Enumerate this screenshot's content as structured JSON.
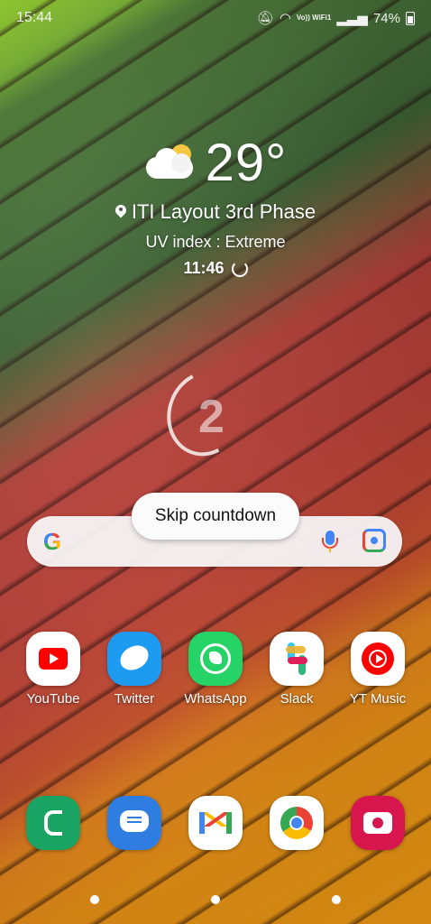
{
  "status_bar": {
    "time": "15:44",
    "signal_label": "Vo)) WiFi1",
    "battery": "74%"
  },
  "weather": {
    "temperature": "29°",
    "location": "ITI Layout 3rd Phase",
    "uv": "UV index : Extreme",
    "updated_time": "11:46"
  },
  "countdown": {
    "number": "2",
    "skip_label": "Skip countdown"
  },
  "search": {
    "google_logo": "G"
  },
  "apps": [
    {
      "label": "YouTube",
      "icon": "youtube-icon"
    },
    {
      "label": "Twitter",
      "icon": "twitter-icon"
    },
    {
      "label": "WhatsApp",
      "icon": "whatsapp-icon"
    },
    {
      "label": "Slack",
      "icon": "slack-icon"
    },
    {
      "label": "YT Music",
      "icon": "yt-music-icon"
    }
  ],
  "dock": [
    {
      "icon": "phone-icon"
    },
    {
      "icon": "messages-icon"
    },
    {
      "icon": "gmail-icon"
    },
    {
      "icon": "chrome-icon"
    },
    {
      "icon": "camera-icon"
    }
  ],
  "colors": {
    "youtube": "#ff0000",
    "twitter": "#1d9bf0",
    "whatsapp": "#25d366",
    "phone": "#19a463",
    "messages": "#2f7de1",
    "camera": "#d6164d"
  }
}
